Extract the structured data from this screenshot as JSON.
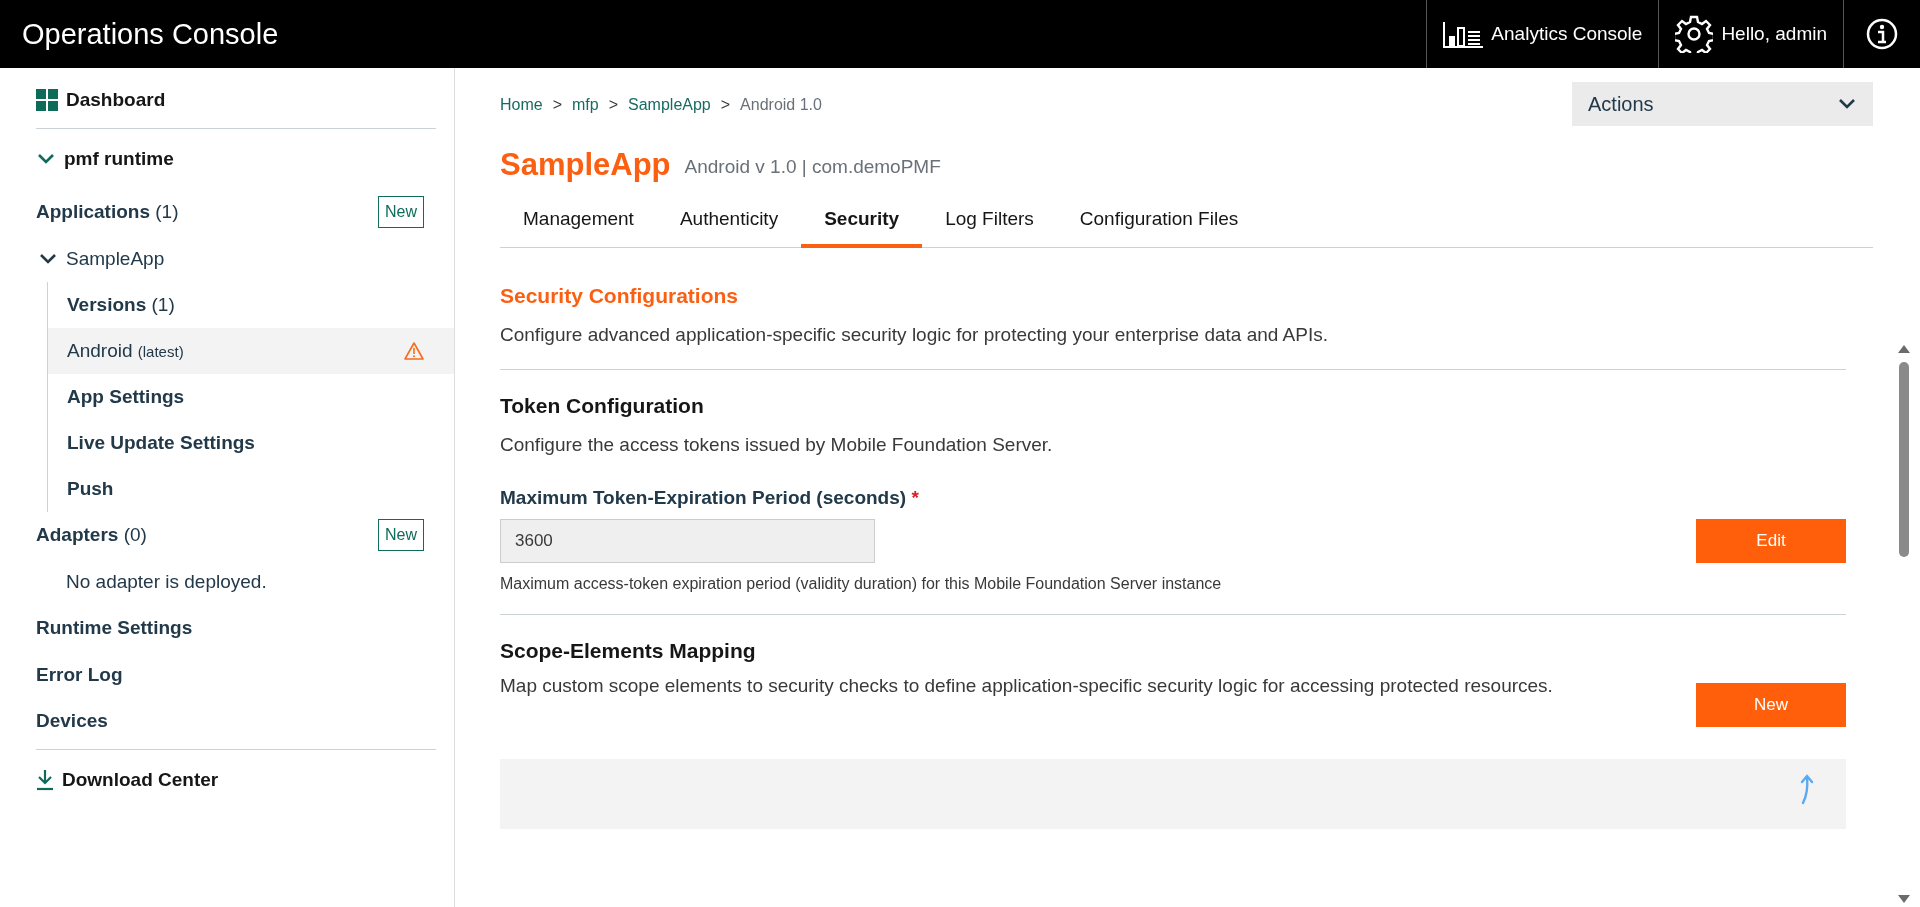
{
  "header": {
    "title": "Operations Console",
    "analytics": "Analytics Console",
    "user": "Hello, admin"
  },
  "sidebar": {
    "items": [
      {
        "kind": "dashboard",
        "label": "Dashboard"
      },
      {
        "kind": "group",
        "label": "pmf runtime",
        "expanded": true
      },
      {
        "kind": "section",
        "label": "Applications",
        "count": "(1)",
        "button": "New"
      },
      {
        "kind": "tree",
        "label": "SampleApp",
        "expanded": true,
        "children": [
          {
            "label": "Versions",
            "count": "(1)",
            "selected": false,
            "warning": false
          },
          {
            "label": "Android",
            "suffix": "(latest)",
            "selected": true,
            "warning": true
          },
          {
            "label": "App Settings",
            "selected": false,
            "warning": false
          },
          {
            "label": "Live Update Settings",
            "selected": false,
            "warning": false
          },
          {
            "label": "Push",
            "selected": false,
            "warning": false
          }
        ]
      },
      {
        "kind": "section",
        "label": "Adapters",
        "count": "(0)",
        "button": "New"
      },
      {
        "kind": "note",
        "label": "No adapter is deployed."
      },
      {
        "kind": "section",
        "label": "Runtime Settings"
      },
      {
        "kind": "section",
        "label": "Error Log"
      },
      {
        "kind": "section",
        "label": "Devices"
      },
      {
        "kind": "download",
        "label": "Download Center"
      }
    ]
  },
  "breadcrumb": {
    "separator": ">",
    "items": [
      "Home",
      "mfp",
      "SampleApp",
      "Android 1.0"
    ]
  },
  "actions": {
    "label": "Actions"
  },
  "app": {
    "name": "SampleApp",
    "subtitle": "Android v 1.0 | com.demoPMF"
  },
  "tabs": [
    {
      "label": "Management",
      "selected": false
    },
    {
      "label": "Authenticity",
      "selected": false
    },
    {
      "label": "Security",
      "selected": true
    },
    {
      "label": "Log Filters",
      "selected": false
    },
    {
      "label": "Configuration Files",
      "selected": false
    }
  ],
  "content": {
    "title": "Security Configurations",
    "description": "Configure advanced application-specific security logic for protecting your enterprise data and APIs.",
    "sections": [
      {
        "kind": "field",
        "title": "Token Configuration",
        "description": "Configure the access tokens issued by Mobile Foundation Server.",
        "field": {
          "label": "Maximum Token-Expiration Period (seconds)",
          "required_mark": "*",
          "value": "3600"
        },
        "help": "Maximum access-token expiration period (validity duration) for this Mobile Foundation Server instance",
        "button": "Edit"
      },
      {
        "kind": "mapping",
        "title": "Scope-Elements Mapping",
        "description": "Map custom scope elements to security checks to define application-specific security logic for accessing protected resources.",
        "button": "New"
      }
    ]
  }
}
